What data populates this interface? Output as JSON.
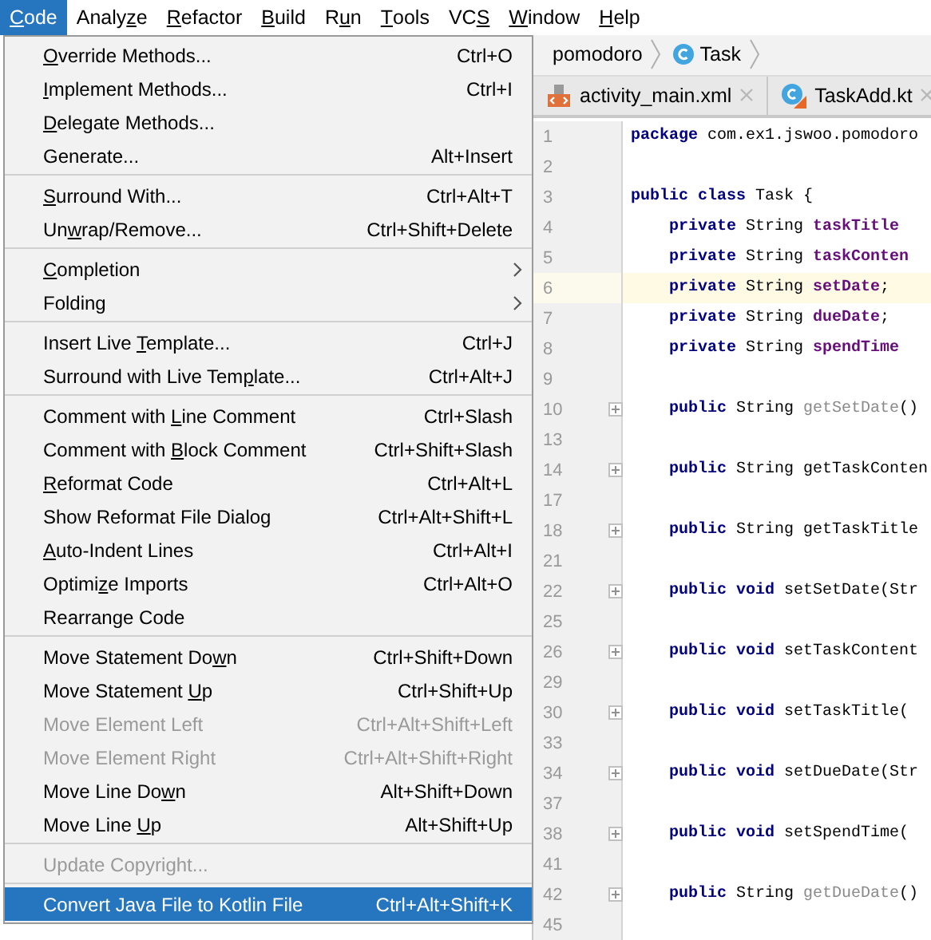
{
  "menubar": [
    {
      "selected": true,
      "label": [
        {
          "t": "C",
          "u": true
        },
        {
          "t": "ode",
          "u": false
        }
      ]
    },
    {
      "selected": false,
      "label": [
        {
          "t": "Analy",
          "u": false
        },
        {
          "t": "z",
          "u": true
        },
        {
          "t": "e",
          "u": false
        }
      ]
    },
    {
      "selected": false,
      "label": [
        {
          "t": "R",
          "u": true
        },
        {
          "t": "efactor",
          "u": false
        }
      ]
    },
    {
      "selected": false,
      "label": [
        {
          "t": "B",
          "u": true
        },
        {
          "t": "uild",
          "u": false
        }
      ]
    },
    {
      "selected": false,
      "label": [
        {
          "t": "R",
          "u": false
        },
        {
          "t": "u",
          "u": true
        },
        {
          "t": "n",
          "u": false
        }
      ]
    },
    {
      "selected": false,
      "label": [
        {
          "t": "T",
          "u": true
        },
        {
          "t": "ools",
          "u": false
        }
      ]
    },
    {
      "selected": false,
      "label": [
        {
          "t": "VC",
          "u": false
        },
        {
          "t": "S",
          "u": true
        }
      ]
    },
    {
      "selected": false,
      "label": [
        {
          "t": "W",
          "u": true
        },
        {
          "t": "indow",
          "u": false
        }
      ]
    },
    {
      "selected": false,
      "label": [
        {
          "t": "H",
          "u": true
        },
        {
          "t": "elp",
          "u": false
        }
      ]
    }
  ],
  "breadcrumb": [
    {
      "kind": "package",
      "label": "pomodoro"
    },
    {
      "kind": "class",
      "label": "Task"
    }
  ],
  "tabs": [
    {
      "kind": "xml",
      "label": "activity_main.xml"
    },
    {
      "kind": "kotlin",
      "label": "TaskAdd.kt"
    }
  ],
  "menu": [
    {
      "kind": "item",
      "label": [
        {
          "t": "O",
          "u": true
        },
        {
          "t": "verride Methods...",
          "u": false
        }
      ],
      "shortcut": "Ctrl+O",
      "submenu": false,
      "disabled": false,
      "selected": false
    },
    {
      "kind": "item",
      "label": [
        {
          "t": "I",
          "u": true
        },
        {
          "t": "mplement Methods...",
          "u": false
        }
      ],
      "shortcut": "Ctrl+I",
      "submenu": false,
      "disabled": false,
      "selected": false
    },
    {
      "kind": "item",
      "label": [
        {
          "t": "D",
          "u": true
        },
        {
          "t": "elegate Methods...",
          "u": false
        }
      ],
      "submenu": false,
      "disabled": false,
      "selected": false
    },
    {
      "kind": "item",
      "label": [
        {
          "t": "Generate...",
          "u": false
        }
      ],
      "shortcut": "Alt+Insert",
      "submenu": false,
      "disabled": false,
      "selected": false
    },
    {
      "kind": "separator"
    },
    {
      "kind": "item",
      "label": [
        {
          "t": "S",
          "u": true
        },
        {
          "t": "urround With...",
          "u": false
        }
      ],
      "shortcut": "Ctrl+Alt+T",
      "submenu": false,
      "disabled": false,
      "selected": false
    },
    {
      "kind": "item",
      "label": [
        {
          "t": "Un",
          "u": false
        },
        {
          "t": "w",
          "u": true
        },
        {
          "t": "rap/Remove...",
          "u": false
        }
      ],
      "shortcut": "Ctrl+Shift+Delete",
      "submenu": false,
      "disabled": false,
      "selected": false
    },
    {
      "kind": "separator"
    },
    {
      "kind": "item",
      "label": [
        {
          "t": "C",
          "u": true
        },
        {
          "t": "ompletion",
          "u": false
        }
      ],
      "submenu": true,
      "disabled": false,
      "selected": false
    },
    {
      "kind": "item",
      "label": [
        {
          "t": "Folding",
          "u": false
        }
      ],
      "submenu": true,
      "disabled": false,
      "selected": false
    },
    {
      "kind": "separator"
    },
    {
      "kind": "item",
      "label": [
        {
          "t": "Insert Live ",
          "u": false
        },
        {
          "t": "T",
          "u": true
        },
        {
          "t": "emplate...",
          "u": false
        }
      ],
      "shortcut": "Ctrl+J",
      "submenu": false,
      "disabled": false,
      "selected": false
    },
    {
      "kind": "item",
      "label": [
        {
          "t": "Surround with Live Tem",
          "u": false
        },
        {
          "t": "p",
          "u": true
        },
        {
          "t": "late...",
          "u": false
        }
      ],
      "shortcut": "Ctrl+Alt+J",
      "submenu": false,
      "disabled": false,
      "selected": false
    },
    {
      "kind": "separator"
    },
    {
      "kind": "item",
      "label": [
        {
          "t": "Comment with ",
          "u": false
        },
        {
          "t": "L",
          "u": true
        },
        {
          "t": "ine Comment",
          "u": false
        }
      ],
      "shortcut": "Ctrl+Slash",
      "submenu": false,
      "disabled": false,
      "selected": false
    },
    {
      "kind": "item",
      "label": [
        {
          "t": "Comment with ",
          "u": false
        },
        {
          "t": "B",
          "u": true
        },
        {
          "t": "lock Comment",
          "u": false
        }
      ],
      "shortcut": "Ctrl+Shift+Slash",
      "submenu": false,
      "disabled": false,
      "selected": false
    },
    {
      "kind": "item",
      "label": [
        {
          "t": "R",
          "u": true
        },
        {
          "t": "eformat Code",
          "u": false
        }
      ],
      "shortcut": "Ctrl+Alt+L",
      "submenu": false,
      "disabled": false,
      "selected": false
    },
    {
      "kind": "item",
      "label": [
        {
          "t": "Show Reformat File Dialog",
          "u": false
        }
      ],
      "shortcut": "Ctrl+Alt+Shift+L",
      "submenu": false,
      "disabled": false,
      "selected": false
    },
    {
      "kind": "item",
      "label": [
        {
          "t": "A",
          "u": true
        },
        {
          "t": "uto-Indent Lines",
          "u": false
        }
      ],
      "shortcut": "Ctrl+Alt+I",
      "submenu": false,
      "disabled": false,
      "selected": false
    },
    {
      "kind": "item",
      "label": [
        {
          "t": "Optimi",
          "u": false
        },
        {
          "t": "z",
          "u": true
        },
        {
          "t": "e Imports",
          "u": false
        }
      ],
      "shortcut": "Ctrl+Alt+O",
      "submenu": false,
      "disabled": false,
      "selected": false
    },
    {
      "kind": "item",
      "label": [
        {
          "t": "Rearrange Code",
          "u": false
        }
      ],
      "submenu": false,
      "disabled": false,
      "selected": false
    },
    {
      "kind": "separator"
    },
    {
      "kind": "item",
      "label": [
        {
          "t": "Move Statement Do",
          "u": false
        },
        {
          "t": "w",
          "u": true
        },
        {
          "t": "n",
          "u": false
        }
      ],
      "shortcut": "Ctrl+Shift+Down",
      "submenu": false,
      "disabled": false,
      "selected": false
    },
    {
      "kind": "item",
      "label": [
        {
          "t": "Move Statement ",
          "u": false
        },
        {
          "t": "U",
          "u": true
        },
        {
          "t": "p",
          "u": false
        }
      ],
      "shortcut": "Ctrl+Shift+Up",
      "submenu": false,
      "disabled": false,
      "selected": false
    },
    {
      "kind": "item",
      "label": [
        {
          "t": "Move Element Left",
          "u": false
        }
      ],
      "shortcut": "Ctrl+Alt+Shift+Left",
      "submenu": false,
      "disabled": true,
      "selected": false
    },
    {
      "kind": "item",
      "label": [
        {
          "t": "Move Element Right",
          "u": false
        }
      ],
      "shortcut": "Ctrl+Alt+Shift+Right",
      "submenu": false,
      "disabled": true,
      "selected": false
    },
    {
      "kind": "item",
      "label": [
        {
          "t": "Move Line Do",
          "u": false
        },
        {
          "t": "w",
          "u": true
        },
        {
          "t": "n",
          "u": false
        }
      ],
      "shortcut": "Alt+Shift+Down",
      "submenu": false,
      "disabled": false,
      "selected": false
    },
    {
      "kind": "item",
      "label": [
        {
          "t": "Move Line ",
          "u": false
        },
        {
          "t": "U",
          "u": true
        },
        {
          "t": "p",
          "u": false
        }
      ],
      "shortcut": "Alt+Shift+Up",
      "submenu": false,
      "disabled": false,
      "selected": false
    },
    {
      "kind": "separator"
    },
    {
      "kind": "item",
      "label": [
        {
          "t": "Update Copyright...",
          "u": false
        }
      ],
      "submenu": false,
      "disabled": true,
      "selected": false
    },
    {
      "kind": "separator"
    },
    {
      "kind": "item",
      "label": [
        {
          "t": "Convert Java File to Kotlin File",
          "u": false
        }
      ],
      "shortcut": "Ctrl+Alt+Shift+K",
      "submenu": false,
      "disabled": false,
      "selected": true
    }
  ],
  "code_lines": [
    {
      "number": "1",
      "current": false,
      "folded": false,
      "indented": false,
      "tokens": [
        {
          "kind": "keyword",
          "text": "package"
        },
        {
          "kind": "plain",
          "text": " com.ex1.jswoo.pomodoro"
        }
      ]
    },
    {
      "number": "2",
      "current": false,
      "folded": false
    },
    {
      "number": "3",
      "current": false,
      "folded": false,
      "indented": false,
      "tokens": [
        {
          "kind": "keyword",
          "text": "public class"
        },
        {
          "kind": "plain",
          "text": " Task {"
        }
      ]
    },
    {
      "number": "4",
      "current": false,
      "folded": false,
      "indented": true,
      "tokens": [
        {
          "kind": "keyword",
          "text": "private"
        },
        {
          "kind": "plain",
          "text": " String "
        },
        {
          "kind": "field",
          "text": "taskTitle"
        }
      ]
    },
    {
      "number": "5",
      "current": false,
      "folded": false,
      "indented": true,
      "tokens": [
        {
          "kind": "keyword",
          "text": "private"
        },
        {
          "kind": "plain",
          "text": " String "
        },
        {
          "kind": "field",
          "text": "taskConten"
        }
      ]
    },
    {
      "number": "6",
      "current": true,
      "folded": false,
      "indented": true,
      "tokens": [
        {
          "kind": "keyword",
          "text": "private"
        },
        {
          "kind": "plain",
          "text": " String "
        },
        {
          "kind": "field",
          "text": "setDate"
        },
        {
          "kind": "plain",
          "text": ";"
        }
      ]
    },
    {
      "number": "7",
      "current": false,
      "folded": false,
      "indented": true,
      "tokens": [
        {
          "kind": "keyword",
          "text": "private"
        },
        {
          "kind": "plain",
          "text": " String "
        },
        {
          "kind": "field",
          "text": "dueDate"
        },
        {
          "kind": "plain",
          "text": ";"
        }
      ]
    },
    {
      "number": "8",
      "current": false,
      "folded": false,
      "indented": true,
      "tokens": [
        {
          "kind": "keyword",
          "text": "private"
        },
        {
          "kind": "plain",
          "text": " String "
        },
        {
          "kind": "field",
          "text": "spendTime"
        }
      ]
    },
    {
      "number": "9",
      "current": false,
      "folded": false
    },
    {
      "number": "10",
      "current": false,
      "folded": true,
      "indented": true,
      "tokens": [
        {
          "kind": "keyword",
          "text": "public"
        },
        {
          "kind": "plain",
          "text": " String "
        },
        {
          "kind": "collapsed",
          "text": "getSetDate"
        },
        {
          "kind": "plain",
          "text": "()"
        }
      ]
    },
    {
      "number": "13",
      "current": false,
      "folded": false
    },
    {
      "number": "14",
      "current": false,
      "folded": true,
      "indented": true,
      "tokens": [
        {
          "kind": "keyword",
          "text": "public"
        },
        {
          "kind": "plain",
          "text": " String getTaskConten"
        }
      ]
    },
    {
      "number": "17",
      "current": false,
      "folded": false
    },
    {
      "number": "18",
      "current": false,
      "folded": true,
      "indented": true,
      "tokens": [
        {
          "kind": "keyword",
          "text": "public"
        },
        {
          "kind": "plain",
          "text": " String getTaskTitle"
        }
      ]
    },
    {
      "number": "21",
      "current": false,
      "folded": false
    },
    {
      "number": "22",
      "current": false,
      "folded": true,
      "indented": true,
      "tokens": [
        {
          "kind": "keyword",
          "text": "public void"
        },
        {
          "kind": "plain",
          "text": " setSetDate(Str"
        }
      ]
    },
    {
      "number": "25",
      "current": false,
      "folded": false
    },
    {
      "number": "26",
      "current": false,
      "folded": true,
      "indented": true,
      "tokens": [
        {
          "kind": "keyword",
          "text": "public void"
        },
        {
          "kind": "plain",
          "text": " setTaskContent"
        }
      ]
    },
    {
      "number": "29",
      "current": false,
      "folded": false
    },
    {
      "number": "30",
      "current": false,
      "folded": true,
      "indented": true,
      "tokens": [
        {
          "kind": "keyword",
          "text": "public void"
        },
        {
          "kind": "plain",
          "text": " setTaskTitle("
        }
      ]
    },
    {
      "number": "33",
      "current": false,
      "folded": false
    },
    {
      "number": "34",
      "current": false,
      "folded": true,
      "indented": true,
      "tokens": [
        {
          "kind": "keyword",
          "text": "public void"
        },
        {
          "kind": "plain",
          "text": " setDueDate(Str"
        }
      ]
    },
    {
      "number": "37",
      "current": false,
      "folded": false
    },
    {
      "number": "38",
      "current": false,
      "folded": true,
      "indented": true,
      "tokens": [
        {
          "kind": "keyword",
          "text": "public void"
        },
        {
          "kind": "plain",
          "text": " setSpendTime("
        }
      ]
    },
    {
      "number": "41",
      "current": false,
      "folded": false
    },
    {
      "number": "42",
      "current": false,
      "folded": true,
      "indented": true,
      "tokens": [
        {
          "kind": "keyword",
          "text": "public"
        },
        {
          "kind": "plain",
          "text": " String "
        },
        {
          "kind": "collapsed",
          "text": "getDueDate"
        },
        {
          "kind": "plain",
          "text": "()"
        }
      ]
    },
    {
      "number": "45",
      "current": false,
      "folded": false
    }
  ]
}
